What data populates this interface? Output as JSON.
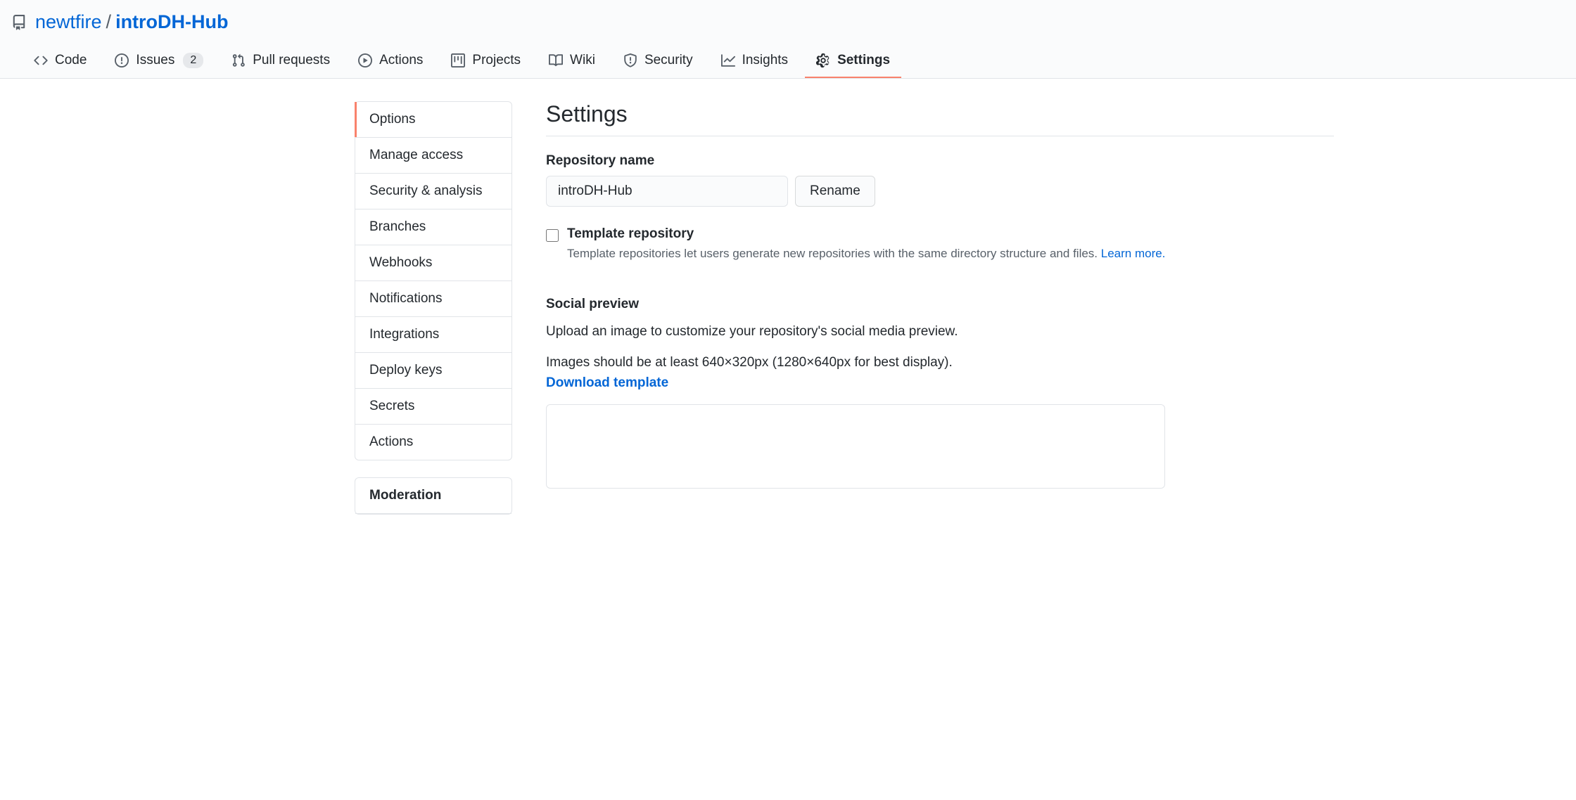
{
  "breadcrumb": {
    "owner": "newtfire",
    "separator": "/",
    "repo": "introDH-Hub"
  },
  "tabs": [
    {
      "label": "Code"
    },
    {
      "label": "Issues",
      "count": "2"
    },
    {
      "label": "Pull requests"
    },
    {
      "label": "Actions"
    },
    {
      "label": "Projects"
    },
    {
      "label": "Wiki"
    },
    {
      "label": "Security"
    },
    {
      "label": "Insights"
    },
    {
      "label": "Settings",
      "active": true
    }
  ],
  "sidebar": {
    "main_items": [
      "Options",
      "Manage access",
      "Security & analysis",
      "Branches",
      "Webhooks",
      "Notifications",
      "Integrations",
      "Deploy keys",
      "Secrets",
      "Actions"
    ],
    "moderation_header": "Moderation"
  },
  "page": {
    "title": "Settings",
    "repo_name_label": "Repository name",
    "repo_name_value": "introDH-Hub",
    "rename_button": "Rename",
    "template_checkbox_label": "Template repository",
    "template_checkbox_desc": "Template repositories let users generate new repositories with the same directory structure and files. ",
    "template_learn_more": "Learn more.",
    "social_title": "Social preview",
    "social_desc1": "Upload an image to customize your repository's social media preview.",
    "social_desc2": "Images should be at least 640×320px (1280×640px for best display).",
    "download_template": "Download template"
  }
}
